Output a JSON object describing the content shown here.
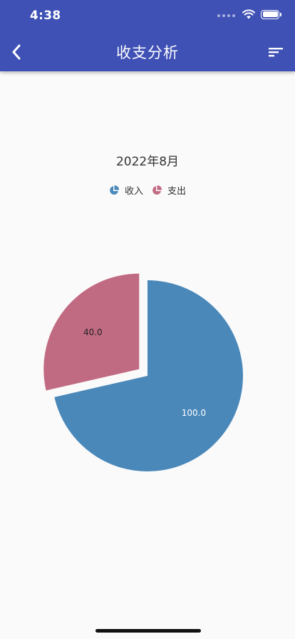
{
  "status_bar": {
    "time": "4:38"
  },
  "app_bar": {
    "title": "收支分析",
    "background": "#3f51b5"
  },
  "chart_data": {
    "type": "pie",
    "title": "2022年8月",
    "legend_placement": "top",
    "categories": [
      "收入",
      "支出"
    ],
    "values": [
      100.0,
      40.0
    ],
    "labels": [
      "100.0",
      "40.0"
    ],
    "colors": [
      "#4a88ba",
      "#c16b82"
    ],
    "exploded": [
      false,
      true
    ],
    "start_angle_deg": 0
  },
  "icons": {
    "back": "chevron-left-icon",
    "sort": "sort-lines-icon",
    "legend_marker": "pie-slice-icon"
  }
}
